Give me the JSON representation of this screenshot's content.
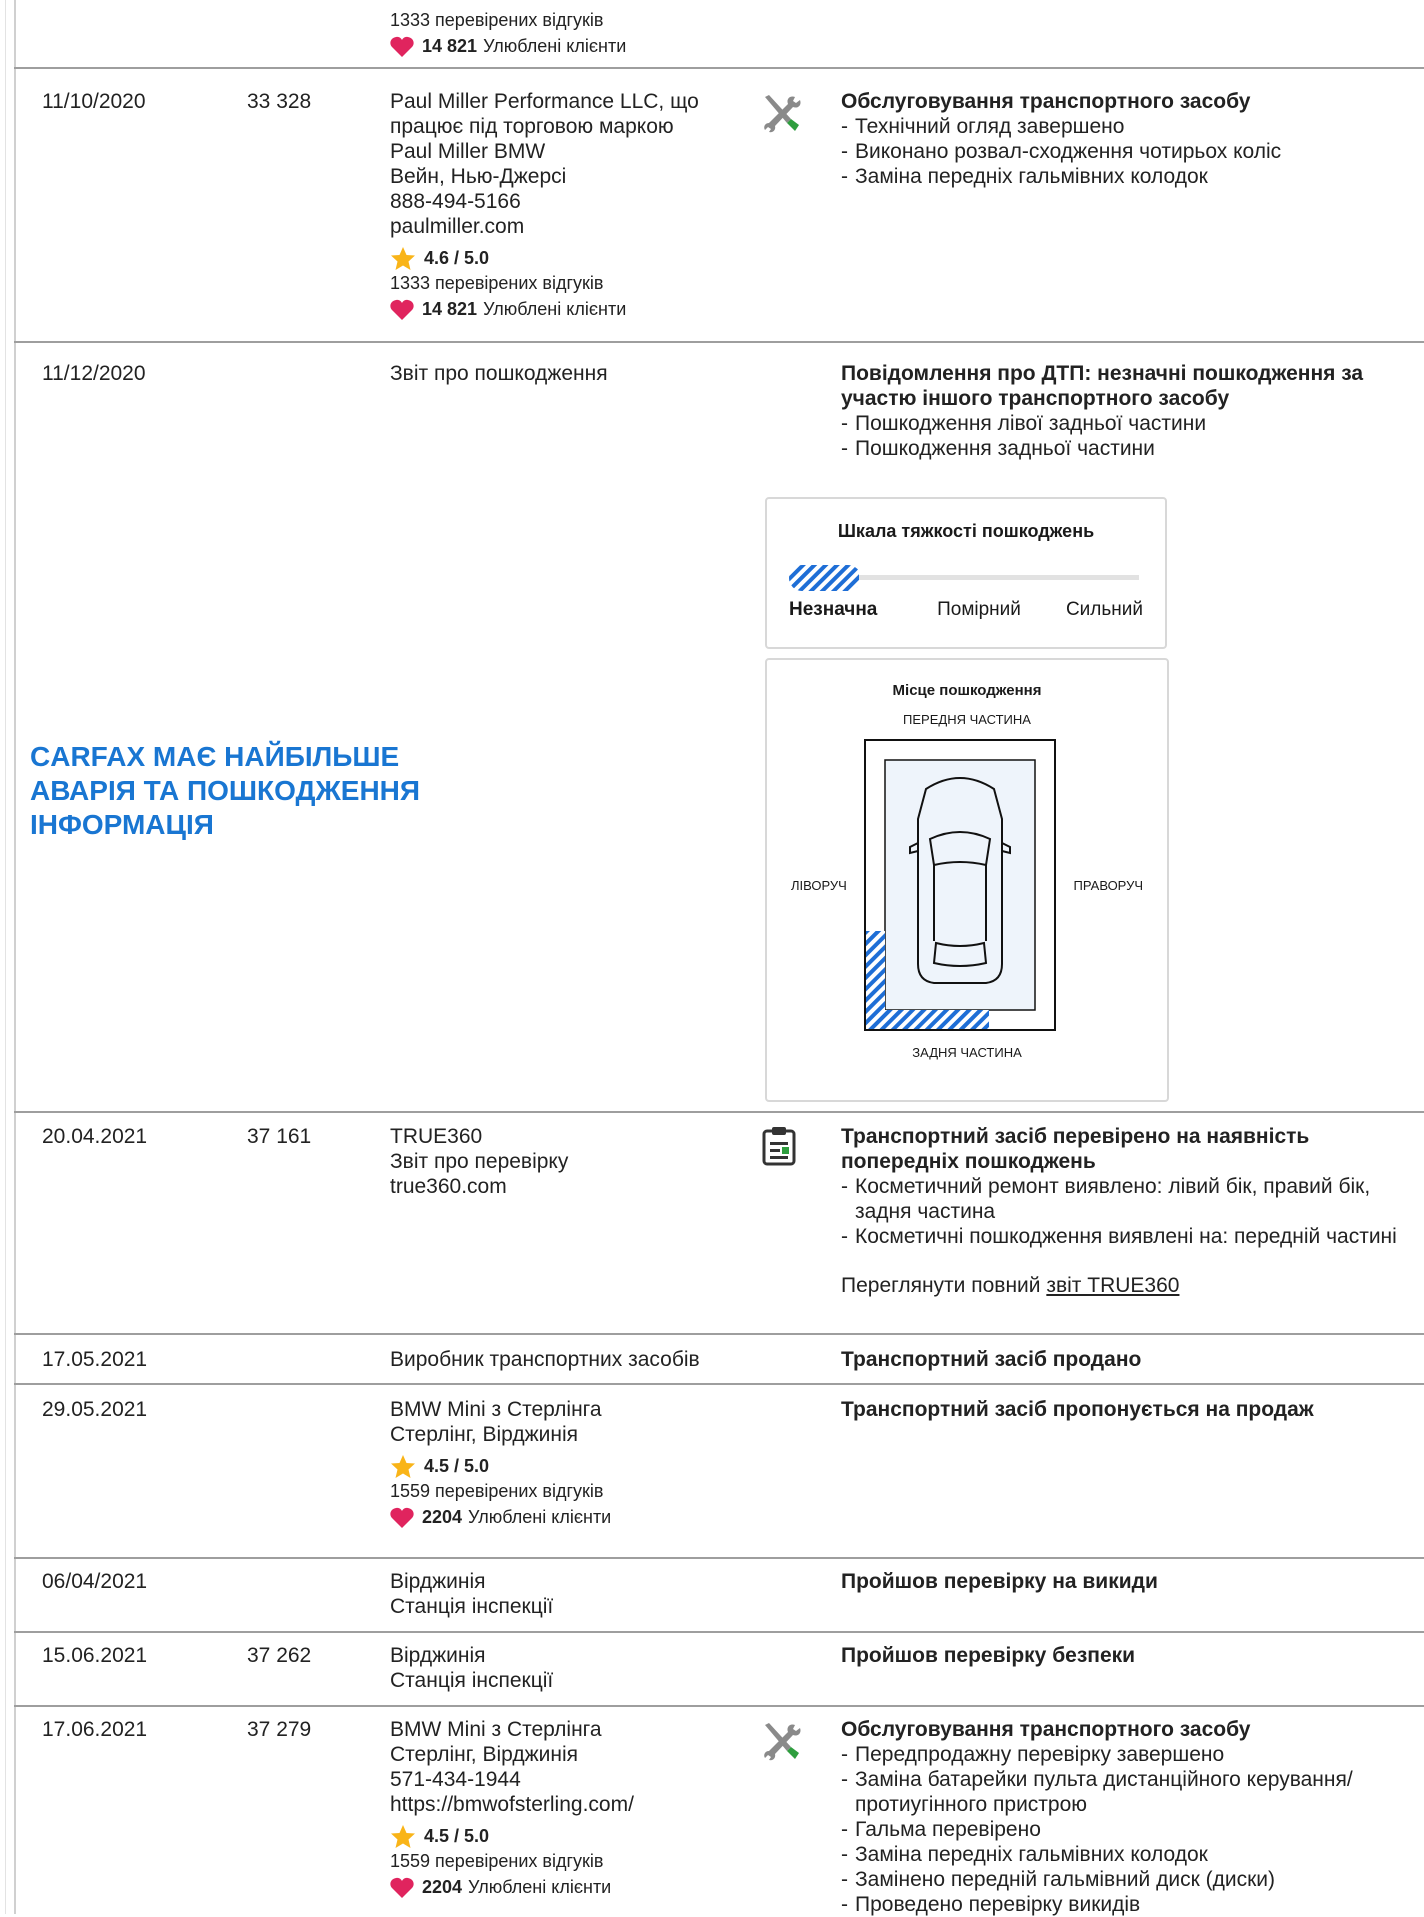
{
  "top_partial": {
    "reviews": "1333 перевірених відгуків",
    "fav_count": "14 821",
    "fav_label": "Улюблені клієнти"
  },
  "records": [
    {
      "date": "11/10/2020",
      "odometer": "33 328",
      "source": [
        "Paul Miller Performance LLC, що працює під торговою маркою",
        "Paul Miller BMW",
        "Вейн, Нью-Джерсі",
        "888-494-5166",
        "paulmiller.com"
      ],
      "rating": "4.6 / 5.0",
      "reviews": "1333 перевірених відгуків",
      "fav_count": "14 821",
      "fav_label": "Улюблені клієнти",
      "icon": "wrench-screwdriver-icon",
      "title": "Обслуговування транспортного засобу",
      "items": [
        "Технічний огляд завершено",
        "Виконано розвал-сходження чотирьох коліс",
        "Заміна передніх гальмівних колодок"
      ]
    },
    {
      "date": "11/12/2020",
      "odometer": "",
      "source": [
        "Звіт про пошкодження"
      ],
      "title": "Повідомлення про ДТП: незначні пошкодження за участю іншого транспортного засобу",
      "items": [
        "Пошкодження лівої задньої частини",
        "Пошкодження задньої частини"
      ]
    },
    {
      "date": "20.04.2021",
      "odometer": "37 161",
      "source": [
        "TRUE360",
        "Звіт про перевірку",
        "true360.com"
      ],
      "icon": "clipboard-icon",
      "title": "Транспортний засіб перевірено на наявність попередніх пошкоджень",
      "items": [
        "Косметичний ремонт виявлено: лівий бік, правий бік, задня частина",
        "Косметичні пошкодження виявлені на: передній частині"
      ],
      "link_prefix": "Переглянути повний ",
      "link_text": "звіт TRUE360"
    },
    {
      "date": "17.05.2021",
      "odometer": "",
      "source": [
        "Виробник транспортних засобів"
      ],
      "title": "Транспортний засіб продано"
    },
    {
      "date": "29.05.2021",
      "odometer": "",
      "source": [
        "BMW Mini з Стерлінга",
        "Стерлінг, Вірджинія"
      ],
      "rating": "4.5 / 5.0",
      "reviews": "1559 перевірених відгуків",
      "fav_count": "2204",
      "fav_label": "Улюблені клієнти",
      "title": "Транспортний засіб пропонується на продаж"
    },
    {
      "date": "06/04/2021",
      "odometer": "",
      "source": [
        "Вірджинія",
        "Станція інспекції"
      ],
      "title": "Пройшов перевірку на викиди"
    },
    {
      "date": "15.06.2021",
      "odometer": "37 262",
      "source": [
        "Вірджинія",
        "Станція інспекції"
      ],
      "title": "Пройшов перевірку безпеки"
    },
    {
      "date": "17.06.2021",
      "odometer": "37 279",
      "source": [
        "BMW Mini з Стерлінга",
        "Стерлінг, Вірджинія",
        "571-434-1944",
        "https://bmwofsterling.com/"
      ],
      "rating": "4.5 / 5.0",
      "reviews": "1559 перевірених відгуків",
      "fav_count": "2204",
      "fav_label": "Улюблені клієнти",
      "icon": "wrench-screwdriver-icon",
      "title": "Обслуговування транспортного засобу",
      "items": [
        "Передпродажну перевірку завершено",
        "Заміна батарейки пульта дистанційного керування/протиугінного пристрою",
        "Гальма перевірено",
        "Заміна передніх гальмівних колодок",
        "Замінено передній гальмівний диск (диски)",
        "Проведено перевірку викидів"
      ]
    }
  ],
  "promo": "CARFAX МАЄ НАЙБІЛЬШЕ АВАРІЯ ТА ПОШКОДЖЕННЯ ІНФОРМАЦІЯ",
  "severity": {
    "title": "Шкала тяжкості пошкоджень",
    "levels": [
      "Незначна",
      "Помірний",
      "Сильний"
    ],
    "selected": "Незначна",
    "fill_fraction": 0.2
  },
  "damage_location": {
    "title": "Місце пошкодження",
    "front": "ПЕРЕДНЯ ЧАСТИНА",
    "rear": "ЗАДНЯ ЧАСТИНА",
    "left": "ЛІВОРУЧ",
    "right": "ПРАВОРУЧ"
  },
  "colors": {
    "accent": "#1976d2",
    "heart": "#e0245e",
    "star": "#f9b418",
    "hatch": "#1e6ed6",
    "wrench_green": "#2e9e3e"
  }
}
